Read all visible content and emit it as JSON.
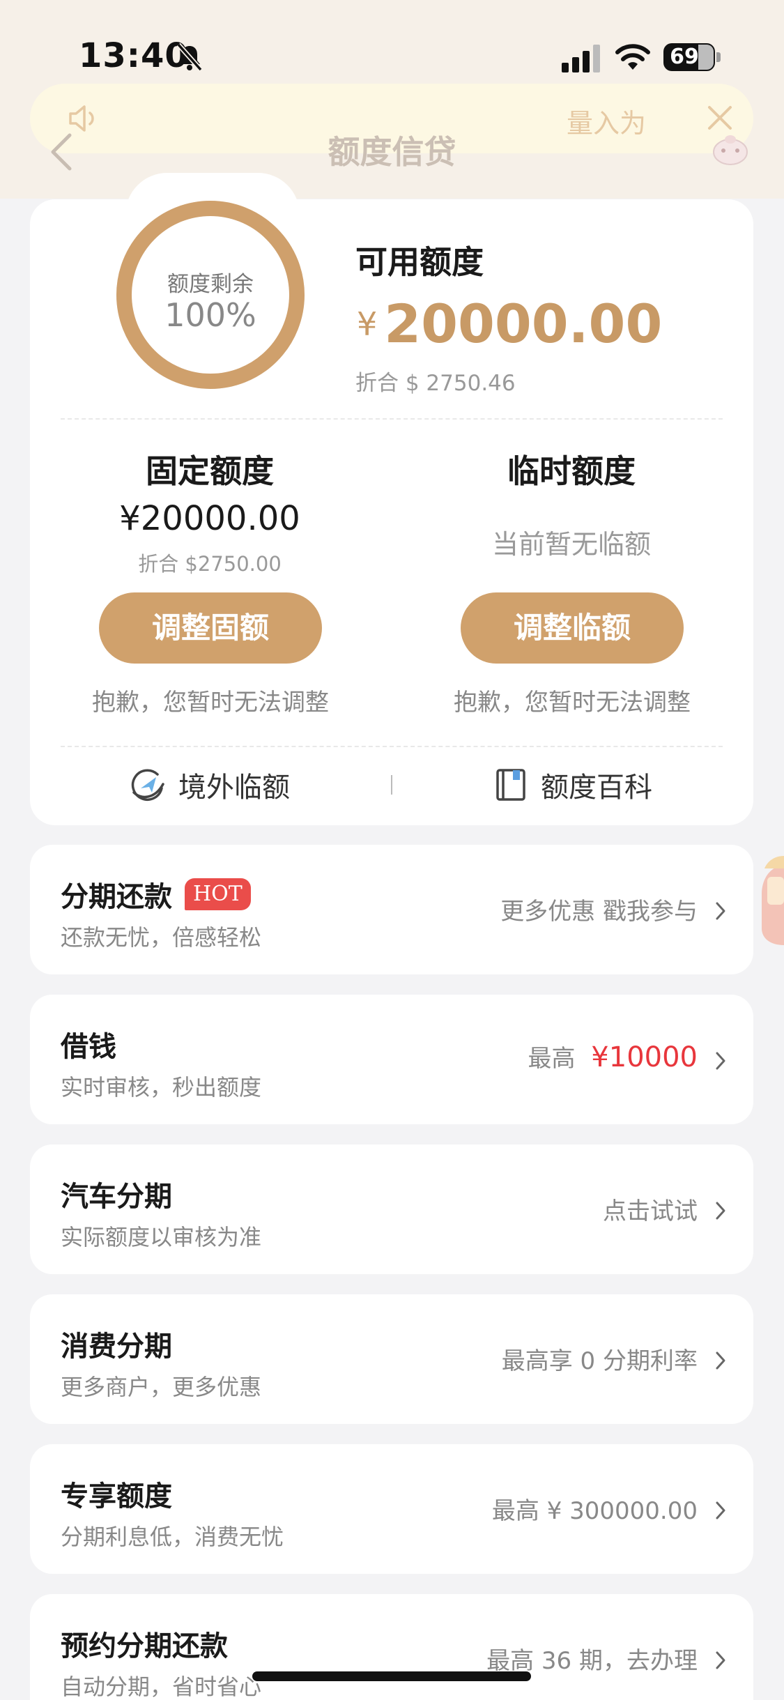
{
  "status_bar": {
    "time": "13:40",
    "battery": "69"
  },
  "notice": {
    "text": "量入为"
  },
  "nav": {
    "title": "额度信贷"
  },
  "credit": {
    "ring_label": "额度剩余",
    "ring_percent": "100%",
    "remaining_fraction": 1.0,
    "available_title": "可用额度",
    "available_currency": "¥",
    "available_amount": "20000.00",
    "available_convert": "折合 $ 2750.46"
  },
  "fixed": {
    "title": "固定额度",
    "amount": "¥20000.00",
    "convert": "折合 $2750.00",
    "button": "调整固额",
    "note": "抱歉，您暂时无法调整"
  },
  "temporary": {
    "title": "临时额度",
    "empty": "当前暂无临额",
    "button": "调整临额",
    "note": "抱歉，您暂时无法调整"
  },
  "links": [
    {
      "label": "境外临额",
      "icon": "overseas-plane-icon"
    },
    {
      "label": "额度百科",
      "icon": "book-icon"
    }
  ],
  "items": [
    {
      "title": "分期还款",
      "badge": "HOT",
      "sub": "还款无忧，倍感轻松",
      "right": "更多优惠 戳我参与",
      "right_prefix": "",
      "right_red": ""
    },
    {
      "title": "借钱",
      "badge": "",
      "sub": "实时审核，秒出额度",
      "right": "",
      "right_prefix": "最高",
      "right_red": "¥10000"
    },
    {
      "title": "汽车分期",
      "badge": "",
      "sub": "实际额度以审核为准",
      "right": "点击试试",
      "right_prefix": "",
      "right_red": ""
    },
    {
      "title": "消费分期",
      "badge": "",
      "sub": "更多商户，更多优惠",
      "right": "最高享 0 分期利率",
      "right_prefix": "",
      "right_red": ""
    },
    {
      "title": "专享额度",
      "badge": "",
      "sub": "分期利息低，消费无忧",
      "right": "最高 ¥ 300000.00",
      "right_prefix": "",
      "right_red": ""
    },
    {
      "title": "预约分期还款",
      "badge": "",
      "sub": "自动分期，省时省心",
      "right": "最高 36 期，去办理",
      "right_prefix": "",
      "right_red": ""
    }
  ],
  "colors": {
    "accent": "#d0a16c",
    "amount": "#c89a66",
    "hot": "#ea4d4a",
    "red": "#e8363c"
  }
}
